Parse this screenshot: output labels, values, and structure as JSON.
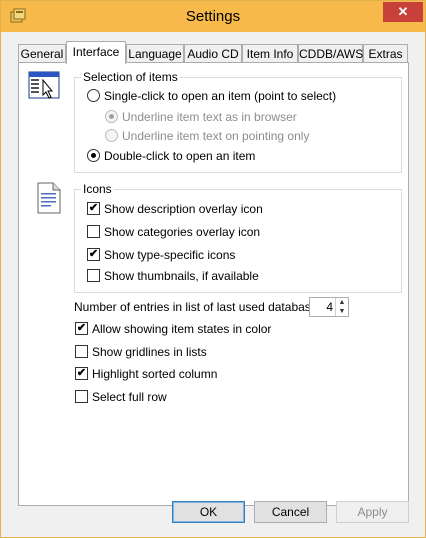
{
  "window": {
    "title": "Settings",
    "close_glyph": "✕"
  },
  "tabs": [
    {
      "label": "General"
    },
    {
      "label": "Interface"
    },
    {
      "label": "Language"
    },
    {
      "label": "Audio CD"
    },
    {
      "label": "Item Info"
    },
    {
      "label": "CDDB/AWS"
    },
    {
      "label": "Extras"
    }
  ],
  "active_tab": "Interface",
  "selection_group": {
    "title": "Selection of items",
    "options": [
      {
        "label": "Single-click to open an item (point to select)",
        "checked": false,
        "enabled": true
      },
      {
        "label": "Underline item text as in browser",
        "checked": true,
        "enabled": false
      },
      {
        "label": "Underline item text on pointing only",
        "checked": false,
        "enabled": false
      },
      {
        "label": "Double-click to open an item",
        "checked": true,
        "enabled": true
      }
    ]
  },
  "icons_group": {
    "title": "Icons",
    "options": [
      {
        "label": "Show description overlay icon",
        "checked": true
      },
      {
        "label": "Show categories overlay icon",
        "checked": false
      },
      {
        "label": "Show type-specific icons",
        "checked": true
      },
      {
        "label": "Show thumbnails, if available",
        "checked": false
      }
    ]
  },
  "last_used": {
    "label": "Number of entries in list of last used databases:",
    "value": "4"
  },
  "options": [
    {
      "label": "Allow showing item states in color",
      "checked": true
    },
    {
      "label": "Show gridlines in lists",
      "checked": false
    },
    {
      "label": "Highlight sorted column",
      "checked": true
    },
    {
      "label": "Select full row",
      "checked": false
    }
  ],
  "buttons": {
    "ok": "OK",
    "cancel": "Cancel",
    "apply": "Apply"
  },
  "check_glyph": "✔",
  "colors": {
    "titlebar": "#f6b94a",
    "close": "#c7403a",
    "default_button_border": "#3c7fb1"
  }
}
